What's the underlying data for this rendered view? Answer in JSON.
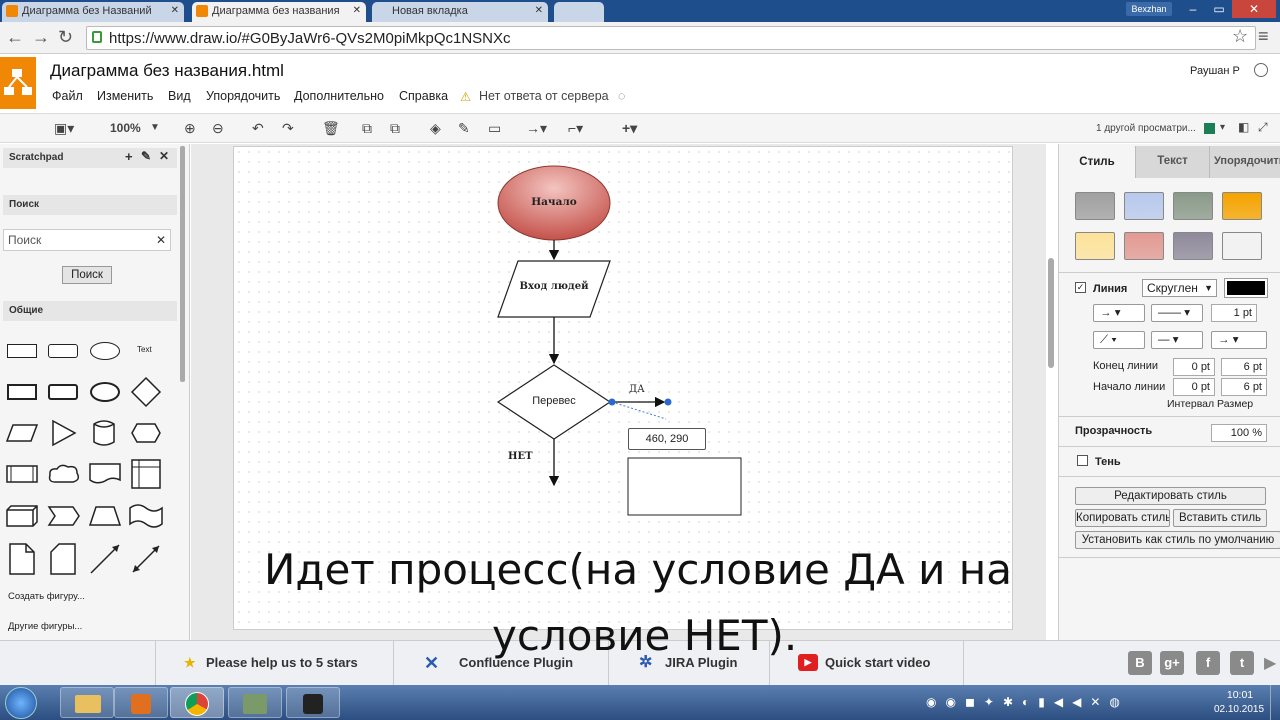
{
  "browser": {
    "tabs": [
      {
        "label": "Диаграмма без Названий",
        "active": false
      },
      {
        "label": "Диаграмма без названия",
        "active": true
      },
      {
        "label": "Новая вкладка",
        "active": false
      }
    ],
    "profile_name": "Bexzhan",
    "url": "https://www.draw.io/#G0ByJaWr6-QVs2M0piMkpQc1NSNXc"
  },
  "app": {
    "doc_title": "Диаграмма без названия.html",
    "user": "Раушан Р",
    "menu": [
      "Файл",
      "Изменить",
      "Вид",
      "Упорядочить",
      "Дополнительно",
      "Справка"
    ],
    "server_status": "Нет ответа от сервера",
    "zoom": "100%",
    "viewers": "1 другой просматри..."
  },
  "left_panel": {
    "scratchpad": "Scratchpad",
    "search_section": "Поиск",
    "search_placeholder": "Поиск",
    "search_button": "Поиск",
    "general_section": "Общие",
    "text_shape": "Text",
    "create_shape": "Создать фигуру...",
    "more_shapes": "Другие фигуры..."
  },
  "diagram": {
    "start": "Начало",
    "input": "Вход людей",
    "decision": "Перевес",
    "yes": "ДА",
    "no": "НЕТ",
    "coords": "460, 290"
  },
  "right_panel": {
    "tabs": [
      "Стиль",
      "Текст",
      "Упорядочить"
    ],
    "line_label": "Линия",
    "line_style": "Скруглен",
    "line_width": "1 pt",
    "line_end_label": "Конец линии",
    "line_start_label": "Начало линии",
    "end_spacing": "0 pt",
    "end_size": "6 pt",
    "start_spacing": "0 pt",
    "start_size": "6 pt",
    "interval_size": "Интервал Размер",
    "opacity_label": "Прозрачность",
    "opacity_value": "100 %",
    "shadow_label": "Тень",
    "edit_style": "Редактировать стиль",
    "copy_style": "Копировать стиль",
    "paste_style": "Вставить стиль",
    "set_default": "Установить как стиль по умолчанию",
    "swatches": [
      "#a0a0a0",
      "#b8c9ec",
      "#8a9a8a",
      "#f5a300",
      "#fde29a",
      "#e29a93",
      "#8f8a9a",
      "#f2f2f2"
    ]
  },
  "footer": {
    "stars": "Please help us to 5 stars",
    "confluence": "Confluence Plugin",
    "jira": "JIRA Plugin",
    "video": "Quick start video"
  },
  "subtitle": {
    "line1": "Идет процесс(на условие ДА и на",
    "line2": "условие НЕТ)."
  },
  "taskbar": {
    "time": "10:01",
    "date": "02.10.2015"
  }
}
